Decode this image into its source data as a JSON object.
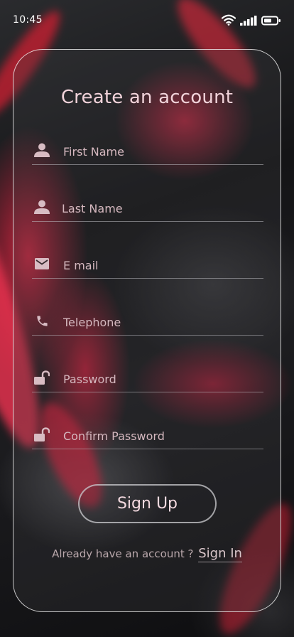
{
  "status_bar": {
    "time": "10:45",
    "icons": [
      "wifi-icon",
      "signal-icon",
      "battery-icon"
    ]
  },
  "form": {
    "title": "Create an account",
    "fields": [
      {
        "icon": "person-icon",
        "placeholder": "First Name",
        "value": ""
      },
      {
        "icon": "person-icon",
        "placeholder": "Last Name",
        "value": ""
      },
      {
        "icon": "mail-icon",
        "placeholder": "E mail",
        "value": ""
      },
      {
        "icon": "phone-icon",
        "placeholder": "Telephone",
        "value": ""
      },
      {
        "icon": "unlock-icon",
        "placeholder": "Password",
        "value": ""
      },
      {
        "icon": "unlock-icon",
        "placeholder": "Confirm Password",
        "value": ""
      }
    ],
    "submit_label": "Sign Up",
    "footer_text": "Already have an account ?",
    "signin_label": "Sign In"
  },
  "colors": {
    "accent_text": "#f1d3da",
    "icon": "#d8bcc3",
    "background_red": "#e6284a"
  }
}
